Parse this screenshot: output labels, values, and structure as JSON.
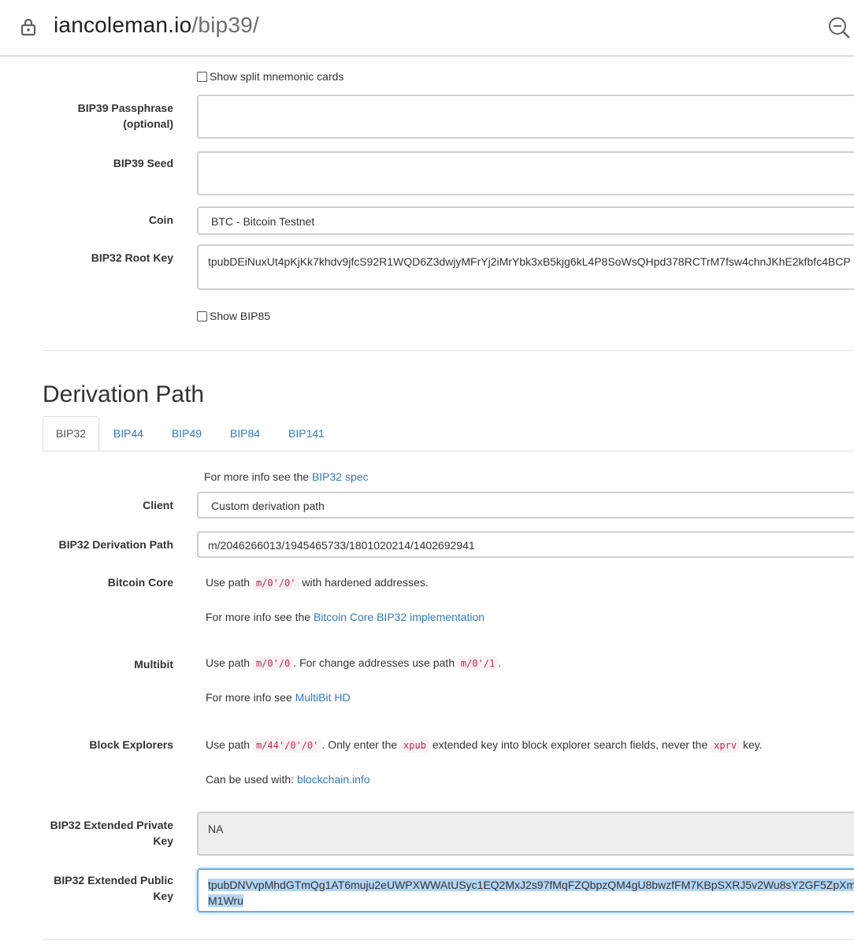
{
  "browser": {
    "url_host": "iancoleman.io",
    "url_path": "/bip39/"
  },
  "top": {
    "split_cards_label": "Show split mnemonic cards",
    "passphrase_label_1": "BIP39 Passphrase",
    "passphrase_label_2": "(optional)",
    "passphrase_value": "",
    "seed_label": "BIP39 Seed",
    "seed_value": "",
    "coin_label": "Coin",
    "coin_value": "BTC - Bitcoin Testnet",
    "root_key_label": "BIP32 Root Key",
    "root_key_value": "tpubDEiNuxUt4pKjKk7khdv9jfcS92R1WQD6Z3dwjyMFrYj2iMrYbk3xB5kjg6kL4P8SoWsQHpd378RCTrM7fsw4chnJKhE2kfbfc4BCP",
    "bip85_label": "Show BIP85"
  },
  "derivation": {
    "heading": "Derivation Path",
    "tabs": [
      "BIP32",
      "BIP44",
      "BIP49",
      "BIP84",
      "BIP141"
    ],
    "info_prefix": "For more info see the",
    "info_link": "BIP32 spec",
    "client_label": "Client",
    "client_value": "Custom derivation path",
    "path_label": "BIP32 Derivation Path",
    "path_value": "m/2046266013/1945465733/1801020214/1402692941",
    "bitcoin_core": {
      "label": "Bitcoin Core",
      "use_path": "Use path",
      "code": "m/0'/0'",
      "suffix": "with hardened addresses.",
      "info_prefix": "For more info see the",
      "info_link": "Bitcoin Core BIP32 implementation"
    },
    "multibit": {
      "label": "Multibit",
      "use_path": "Use path",
      "code1": "m/0'/0",
      "mid": ". For change addresses use path",
      "code2": "m/0'/1",
      "end": ".",
      "info_prefix": "For more info see",
      "info_link": "MultiBit HD"
    },
    "explorers": {
      "label": "Block Explorers",
      "use_path": "Use path",
      "code1": "m/44'/0'/0'",
      "mid": ". Only enter the",
      "code2": "xpub",
      "mid2": "extended key into block explorer search fields, never the",
      "code3": "xprv",
      "end": "key.",
      "can_use": "Can be used with:",
      "link": "blockchain.info"
    },
    "ext_priv_label_1": "BIP32 Extended Private",
    "ext_priv_label_2": "Key",
    "ext_priv_value": "NA",
    "ext_pub_label_1": "BIP32 Extended Public",
    "ext_pub_label_2": "Key",
    "ext_pub_line1": "tpubDNVvpMhdGTmQg1AT6muju2eUWPXWWAtUSyc1EQ2MxJ2s97fMqFZQbpzQM4gU8bwzfFM7KBpSXRJ5v2Wu8sY2GF5ZpXm",
    "ext_pub_line2": "M1Wru"
  }
}
